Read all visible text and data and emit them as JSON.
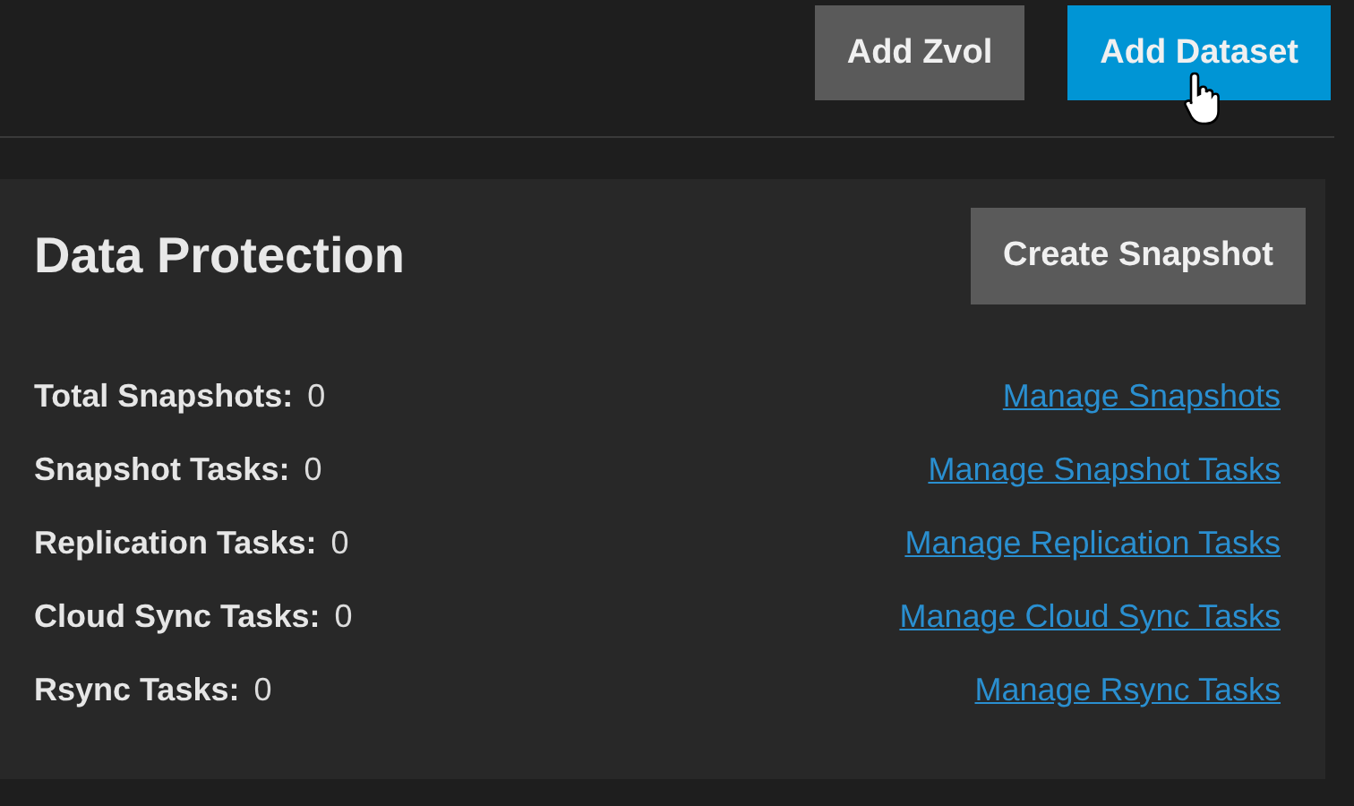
{
  "toolbar": {
    "buttons": [
      {
        "label": "Add Zvol",
        "kind": "secondary"
      },
      {
        "label": "Add Dataset",
        "kind": "primary"
      }
    ]
  },
  "card": {
    "title": "Data Protection",
    "action": "Create Snapshot",
    "rows": [
      {
        "label": "Total Snapshots:",
        "value": "0",
        "link": "Manage Snapshots"
      },
      {
        "label": "Snapshot Tasks:",
        "value": "0",
        "link": "Manage Snapshot Tasks"
      },
      {
        "label": "Replication Tasks:",
        "value": "0",
        "link": "Manage Replication Tasks"
      },
      {
        "label": "Cloud Sync Tasks:",
        "value": "0",
        "link": "Manage Cloud Sync Tasks"
      },
      {
        "label": "Rsync Tasks:",
        "value": "0",
        "link": "Manage Rsync Tasks"
      }
    ]
  }
}
